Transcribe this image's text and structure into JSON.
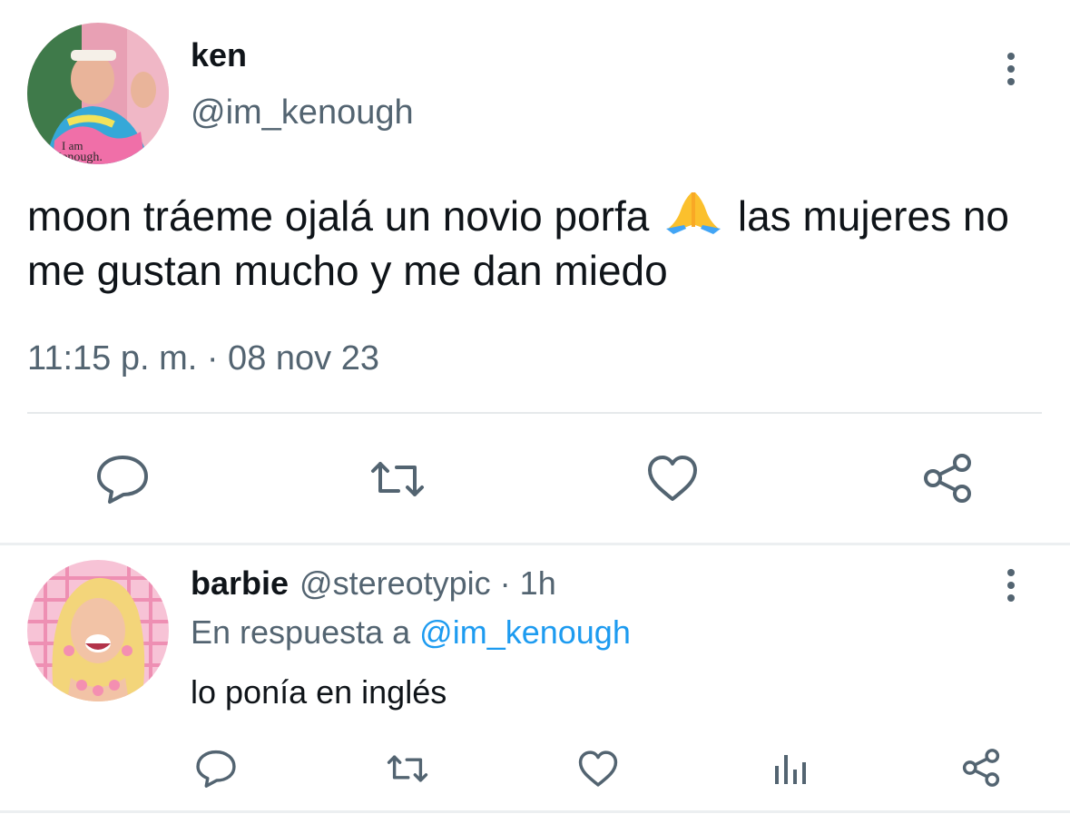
{
  "tweet": {
    "author_name": "ken",
    "author_handle": "@im_kenough",
    "avatar_caption_line1": "I am",
    "avatar_caption_line2": "Kenough.",
    "text_part1": "moon tráeme ojalá un novio porfa",
    "text_part2": "las mujeres no me gustan mucho y me dan miedo",
    "emoji": "folded-hands",
    "timestamp": "11:15 p. m. · 08 nov 23"
  },
  "reply": {
    "author_name": "barbie",
    "author_handle": "@stereotypic",
    "separator": " · ",
    "time": "1h",
    "in_reply_prefix": "En respuesta a ",
    "in_reply_mention": "@im_kenough",
    "text": "lo ponía en inglés"
  },
  "icons": {
    "reply": "speech-bubble-icon",
    "retweet": "retweet-icon",
    "like": "heart-icon",
    "share": "share-icon",
    "views": "bar-chart-icon",
    "more": "vertical-dots-icon"
  },
  "colors": {
    "text": "#0f1419",
    "secondary": "#536471",
    "link": "#1d9bf0",
    "divider": "#e6e9eb"
  }
}
